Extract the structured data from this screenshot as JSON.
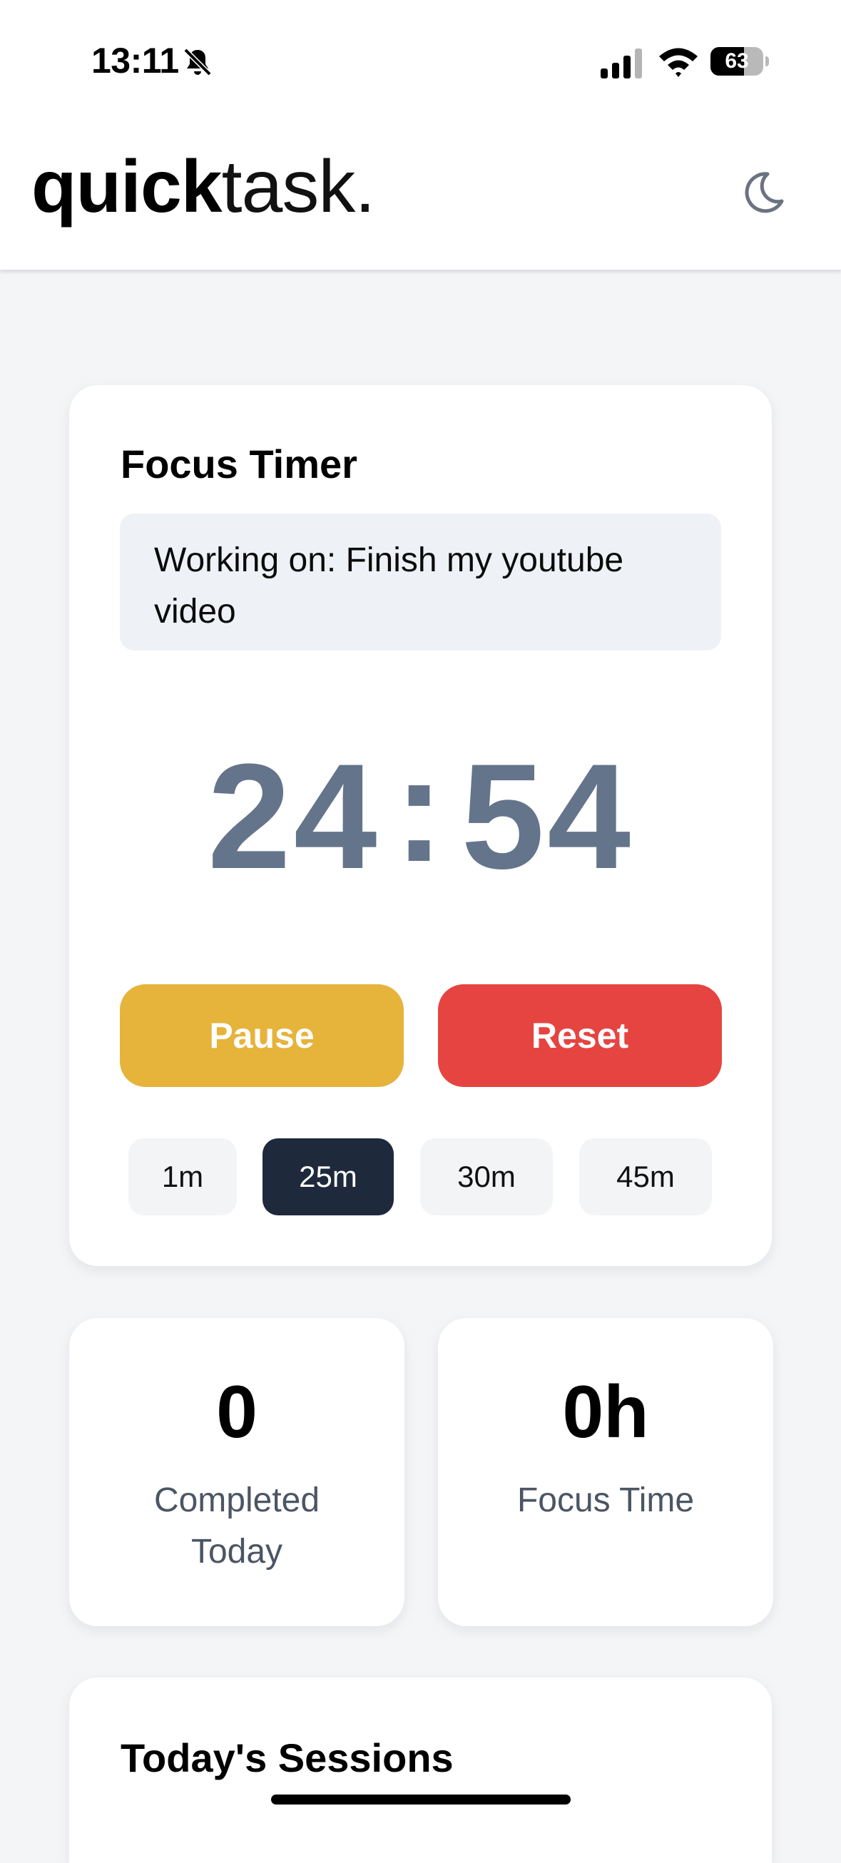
{
  "status_bar": {
    "time": "13:11",
    "battery_percent": "63",
    "battery_level": 0.63,
    "icons": [
      "bell-slash-icon",
      "cellular-signal-icon",
      "wifi-icon",
      "battery-icon"
    ]
  },
  "header": {
    "logo_strong": "quick",
    "logo_light": "task.",
    "theme_toggle_icon": "moon-icon"
  },
  "timer": {
    "title": "Focus Timer",
    "working_on": "Working on: Finish my youtube video",
    "minutes": "24",
    "separator": ":",
    "seconds": "54",
    "pause_label": "Pause",
    "reset_label": "Reset",
    "presets": [
      "1m",
      "25m",
      "30m",
      "45m"
    ],
    "active_preset": "25m"
  },
  "stats": {
    "completed_value": "0",
    "completed_label": "Completed Today",
    "focus_value": "0h",
    "focus_label": "Focus Time"
  },
  "sessions": {
    "title": "Today's Sessions"
  },
  "colors": {
    "pause": "#e6b33b",
    "reset": "#e64441",
    "timer_digits": "#64748b",
    "active_preset": "#1e293b",
    "task_box": "#eef2f6",
    "background": "#f4f5f7"
  }
}
